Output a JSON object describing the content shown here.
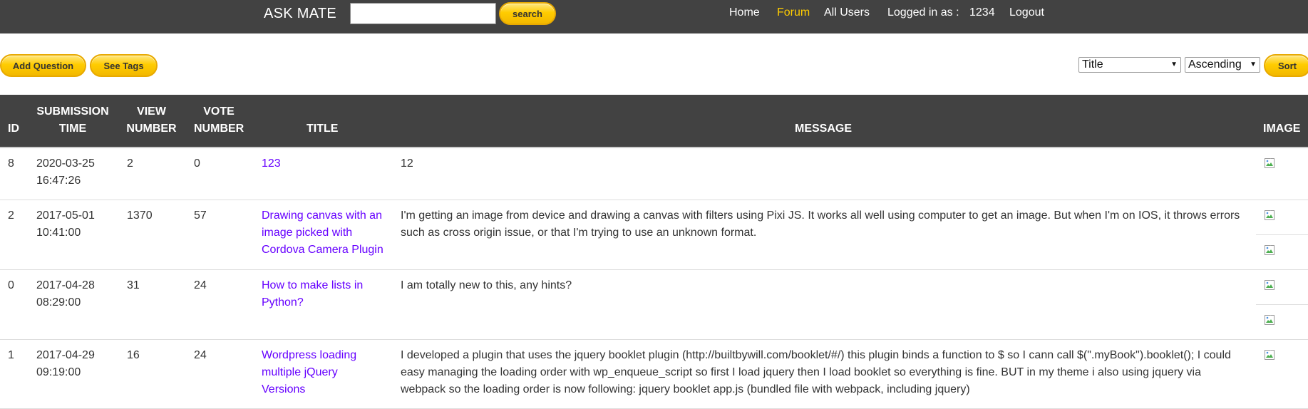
{
  "header": {
    "brand": "ASK MATE",
    "search_placeholder": "",
    "search_button": "search",
    "nav": {
      "home": "Home",
      "forum": "Forum",
      "all_users": "All Users",
      "logged_in_label": "Logged in as :",
      "username": "1234",
      "logout": "Logout"
    },
    "active_color": "#ffcc00",
    "bar_color": "#424242"
  },
  "actions": {
    "add_question": "Add Question",
    "see_tags": "See Tags",
    "sort_field": "Title",
    "sort_order": "Ascending",
    "sort_button": "Sort",
    "button_color": "#ffcc00"
  },
  "table": {
    "columns": {
      "id": "ID",
      "submission_1": "SUBMISSION",
      "submission_2": "TIME",
      "view_1": "VIEW",
      "view_2": "NUMBER",
      "vote_1": "VOTE",
      "vote_2": "NUMBER",
      "title": "TITLE",
      "message": "MESSAGE",
      "image": "IMAGE"
    },
    "link_color": "#6600ff",
    "rows": [
      {
        "id": "8",
        "date": "2020-03-25",
        "time": "16:47:26",
        "view": "2",
        "vote": "0",
        "title_lines": [
          "123"
        ],
        "message_lines": [
          "12"
        ],
        "images": 1
      },
      {
        "id": "2",
        "date": "2017-05-01",
        "time": "10:41:00",
        "view": "1370",
        "vote": "57",
        "title_lines": [
          "Drawing canvas with an",
          "image picked with",
          "Cordova Camera Plugin"
        ],
        "message_lines": [
          "I'm getting an image from device and drawing a canvas with filters using Pixi JS. It works all well using computer to get an image. But when I'm on IOS, it throws errors",
          "such as cross origin issue, or that I'm trying to use an unknown format."
        ],
        "images": 2
      },
      {
        "id": "0",
        "date": "2017-04-28",
        "time": "08:29:00",
        "view": "31",
        "vote": "24",
        "title_lines": [
          "How to make lists in",
          "Python?"
        ],
        "message_lines": [
          "I am totally new to this, any hints?"
        ],
        "images": 2
      },
      {
        "id": "1",
        "date": "2017-04-29",
        "time": "09:19:00",
        "view": "16",
        "vote": "24",
        "title_lines": [
          "Wordpress loading",
          "multiple jQuery",
          "Versions"
        ],
        "message_lines": [
          "I developed a plugin that uses the jquery booklet plugin (http://builtbywill.com/booklet/#/) this plugin binds a function to $ so I cann call $(\".myBook\").booklet(); I could",
          "easy managing the loading order with wp_enqueue_script so first I load jquery then I load booklet so everything is fine. BUT in my theme i also using jquery via",
          "webpack so the loading order is now following: jquery booklet app.js (bundled file with webpack, including jquery)"
        ],
        "images": 1
      }
    ]
  }
}
